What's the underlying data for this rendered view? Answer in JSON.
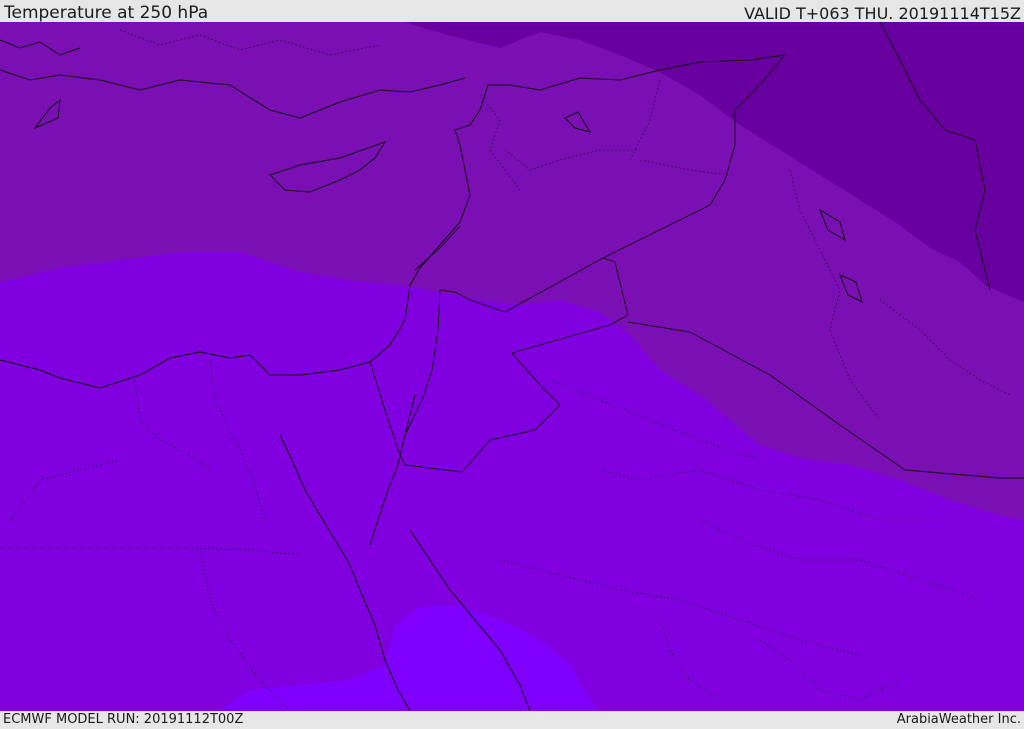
{
  "header": {
    "title": "Temperature at 250 hPa",
    "valid": "VALID T+063 THU. 20191114T15Z"
  },
  "footer": {
    "model_run": "ECMWF MODEL RUN: 20191112T00Z",
    "credit": "ArabiaWeather Inc."
  },
  "map": {
    "fill_colors": [
      "#6800a0",
      "#7a10b4",
      "#8000e0",
      "#7f00ff"
    ]
  }
}
